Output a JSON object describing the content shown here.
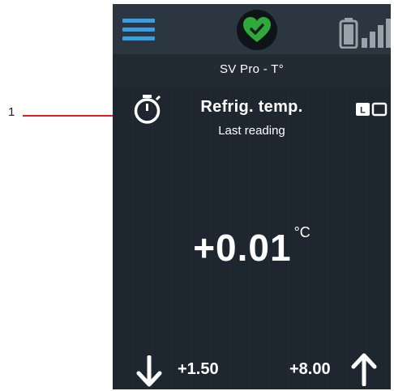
{
  "annotation": {
    "callout_number": "1"
  },
  "header": {
    "menu_icon": "hamburger-menu-icon",
    "status_icon": "heart-check-icon",
    "status_color": "#2fa93a",
    "battery_icon": "battery-icon",
    "signal_icon": "signal-strength-icon",
    "device_name": "SV Pro - T°"
  },
  "measurement": {
    "icon": "stopwatch-icon",
    "title": "Refrig. temp.",
    "subtitle": "Last reading",
    "value": "+0.01",
    "unit": "°C",
    "badge_letter": "L"
  },
  "limits": {
    "low_icon": "arrow-down-icon",
    "low": "+1.50",
    "high": "+8.00",
    "high_icon": "arrow-up-icon"
  },
  "colors": {
    "accent": "#3a9ee4",
    "background": "#1e2730",
    "annotation": "#e31c23"
  }
}
